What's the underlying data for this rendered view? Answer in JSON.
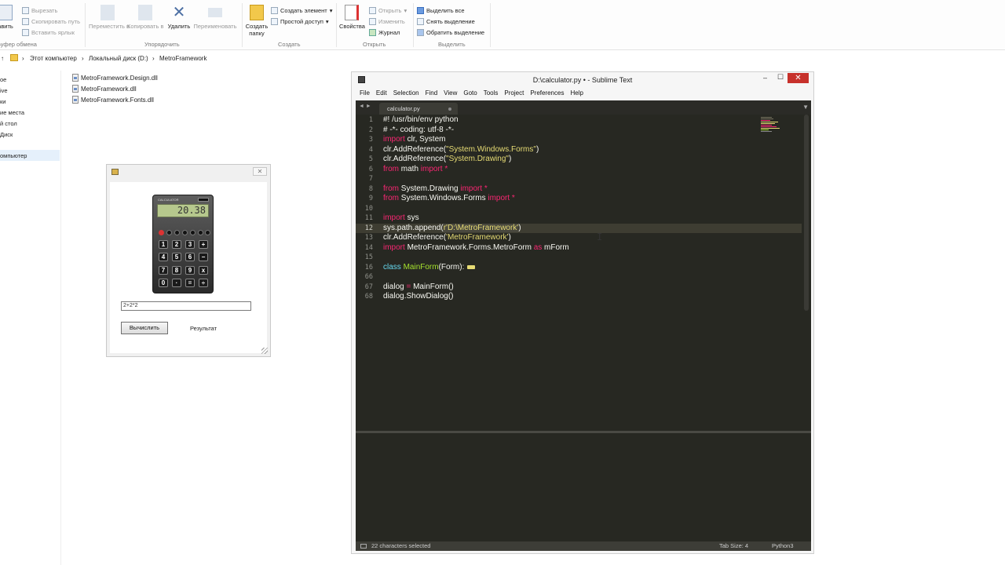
{
  "ribbon": {
    "groups": {
      "clipboard": "Буфер обмена",
      "organize": "Упорядочить",
      "create": "Создать",
      "open": "Открыть",
      "select": "Выделить"
    },
    "clipboard": {
      "paste_partial": "авить",
      "cut": "Вырезать",
      "copy_path": "Скопировать путь",
      "paste_shortcut": "Вставить ярлык"
    },
    "organize": {
      "move": "Переместить в",
      "copy": "Копировать в",
      "delete": "Удалить",
      "rename": "Переименовать"
    },
    "create": {
      "new_folder": "Создать папку",
      "new_item": "Создать элемент",
      "easy_access": "Простой доступ"
    },
    "open": {
      "properties": "Свойства",
      "open": "Открыть",
      "edit": "Изменить",
      "history": "Журнал"
    },
    "select": {
      "select_all": "Выделить все",
      "select_none": "Снять выделение",
      "invert": "Обратить выделение"
    }
  },
  "address": {
    "up_arrow": "↑",
    "crumbs": [
      "Этот компьютер",
      "Локальный диск (D:)",
      "MetroFramework"
    ],
    "sep": "›"
  },
  "nav": {
    "items": [
      "ое",
      "ive",
      "ки",
      "ие места",
      "й стол",
      "Диск",
      "омпьютер"
    ]
  },
  "files": [
    "MetroFramework.Design.dll",
    "MetroFramework.dll",
    "MetroFramework.Fonts.dll"
  ],
  "form": {
    "close_glyph": "✕",
    "calculator": {
      "display": "20.38",
      "brand": "CALCULATOR",
      "keys": [
        "1",
        "2",
        "3",
        "+",
        "4",
        "5",
        "6",
        "−",
        "7",
        "8",
        "9",
        "x",
        "0",
        "·",
        "=",
        "÷"
      ]
    },
    "expression": "2+2*2",
    "calc_button": "Вычислить",
    "result_label": "Результат"
  },
  "sublime": {
    "title": "D:\\calculator.py • - Sublime Text",
    "min": "–",
    "max": "☐",
    "close": "✕",
    "menu": [
      "File",
      "Edit",
      "Selection",
      "Find",
      "View",
      "Goto",
      "Tools",
      "Project",
      "Preferences",
      "Help"
    ],
    "tab_arrows": "◄ ►",
    "tab_drop": "▼",
    "tab_name": "calculator.py",
    "line_numbers": [
      "1",
      "2",
      "3",
      "4",
      "5",
      "6",
      "7",
      "8",
      "9",
      "10",
      "11",
      "12",
      "13",
      "14",
      "15",
      "16",
      "66",
      "67",
      "68"
    ],
    "code": {
      "l1": "#! /usr/bin/env python",
      "l2": "# -*- coding: utf-8 -*-",
      "l3_kw": "import",
      "l3_rest": " clr, System",
      "l4_a": "clr.AddReference(",
      "l4_s": "\"System.Windows.Forms\"",
      "l4_b": ")",
      "l5_a": "clr.AddReference(",
      "l5_s": "\"System.Drawing\"",
      "l5_b": ")",
      "l6_kw1": "from",
      "l6_mid": " math ",
      "l6_kw2": "import *",
      "l8_kw1": "from",
      "l8_mid": " System.Drawing ",
      "l8_kw2": "import *",
      "l9_kw1": "from",
      "l9_mid": " System.Windows.Forms ",
      "l9_kw2": "import *",
      "l11_kw": "import",
      "l11_rest": " sys",
      "l12_a": "sys.path.append(",
      "l12_s": "r'D:\\MetroFramework'",
      "l12_b": ")",
      "l13_a": "clr.AddReference(",
      "l13_s": "'MetroFramework'",
      "l13_b": ")",
      "l14_kw": "import",
      "l14_mid": " MetroFramework.Forms.MetroForm ",
      "l14_as": "as",
      "l14_rest": " mForm",
      "l16_kw": "class",
      "l16_name": " MainForm",
      "l16_rest": "(Form):",
      "l67_a": "dialog ",
      "l67_op": "=",
      "l67_b": " MainForm()",
      "l68": "dialog.ShowDialog()"
    },
    "status": {
      "selection": "22 characters selected",
      "tab_size": "Tab Size: 4",
      "syntax": "Python3"
    }
  },
  "cursor_glyph": "I"
}
